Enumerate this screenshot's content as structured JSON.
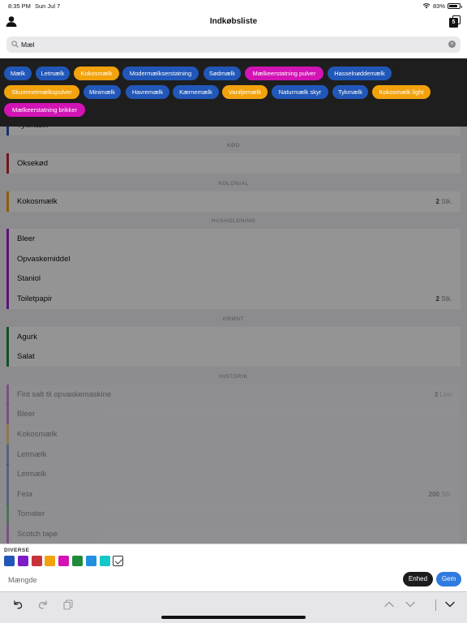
{
  "status": {
    "time": "8:35 PM",
    "date": "Sun Jul 7",
    "battery": "83%",
    "battery_level": 0.83
  },
  "header": {
    "title": "Indkøbsliste",
    "badge": "5"
  },
  "search": {
    "value": "Mæl",
    "placeholder": ""
  },
  "suggestions": [
    {
      "label": "Mælk",
      "color": "#2157b8"
    },
    {
      "label": "Letmælk",
      "color": "#2157b8"
    },
    {
      "label": "Kokosmælk",
      "color": "#f2a20c"
    },
    {
      "label": "Modermælkserstatning",
      "color": "#2157b8"
    },
    {
      "label": "Sødmælk",
      "color": "#2157b8"
    },
    {
      "label": "Mælkeerstatning pulver",
      "color": "#d214b4"
    },
    {
      "label": "Hasselnøddemælk",
      "color": "#2157b8"
    },
    {
      "label": "Skummetmælkspulver",
      "color": "#f2a20c"
    },
    {
      "label": "Minimælk",
      "color": "#2157b8"
    },
    {
      "label": "Havremælk",
      "color": "#2157b8"
    },
    {
      "label": "Kærnemælk",
      "color": "#2157b8"
    },
    {
      "label": "Vaniljemælk",
      "color": "#f2a20c"
    },
    {
      "label": "Naturmælk skyr",
      "color": "#2157b8"
    },
    {
      "label": "Tykmælk",
      "color": "#2157b8"
    },
    {
      "label": "Kokosmælk light",
      "color": "#f2a20c"
    },
    {
      "label": "Mælkeerstatning brikker",
      "color": "#d214b4"
    }
  ],
  "list": {
    "partial_row": {
      "name": "Tykmælk",
      "color": "#2157b8"
    },
    "sections": [
      {
        "title": "KØD",
        "items": [
          {
            "name": "Oksekød",
            "qty": "",
            "unit": "",
            "color": "#c0282d"
          }
        ]
      },
      {
        "title": "KOLONIAL",
        "items": [
          {
            "name": "Kokosmælk",
            "qty": "2",
            "unit": "Stk.",
            "color": "#f2a20c"
          }
        ]
      },
      {
        "title": "HUSHOLDNING",
        "items": [
          {
            "name": "Bleer",
            "qty": "",
            "unit": "",
            "color": "#a020c8"
          },
          {
            "name": "Opvaskemiddel",
            "qty": "",
            "unit": "",
            "color": "#a020c8"
          },
          {
            "name": "Staniol",
            "qty": "",
            "unit": "",
            "color": "#a020c8"
          },
          {
            "name": "Toiletpapir",
            "qty": "2",
            "unit": "Stk.",
            "color": "#a020c8"
          }
        ]
      },
      {
        "title": "GRØNT",
        "items": [
          {
            "name": "Agurk",
            "qty": "",
            "unit": "",
            "color": "#1f8a3a"
          },
          {
            "name": "Salat",
            "qty": "",
            "unit": "",
            "color": "#1f8a3a"
          }
        ]
      },
      {
        "title": "HISTORIK",
        "items": [
          {
            "name": "Fint salt til opvaskemaskine",
            "qty": "3",
            "unit": "Liter",
            "color": "#a020c8"
          },
          {
            "name": "Bleer",
            "qty": "",
            "unit": "",
            "color": "#a020c8"
          },
          {
            "name": "Kokosmælk",
            "qty": "",
            "unit": "",
            "color": "#f2a20c"
          },
          {
            "name": "Letmælk",
            "qty": "",
            "unit": "",
            "color": "#2157b8"
          },
          {
            "name": "Letmælk",
            "qty": "",
            "unit": "",
            "color": "#2157b8"
          },
          {
            "name": "Feta",
            "qty": "200",
            "unit": "Stk.",
            "color": "#2157b8"
          },
          {
            "name": "Tomater",
            "qty": "",
            "unit": "",
            "color": "#1f8a3a"
          },
          {
            "name": "Scotch tape",
            "qty": "",
            "unit": "",
            "color": "#a020c8"
          }
        ]
      }
    ]
  },
  "editor": {
    "category": "DIVERSE",
    "colors": [
      "#2157b8",
      "#7d1cc8",
      "#c8323c",
      "#f2a20c",
      "#d214b4",
      "#1f8a3a",
      "#2190e0",
      "#14c8c8"
    ],
    "amount_placeholder": "Mængde",
    "unit_button": "Enhed",
    "save_button": "Gem"
  }
}
